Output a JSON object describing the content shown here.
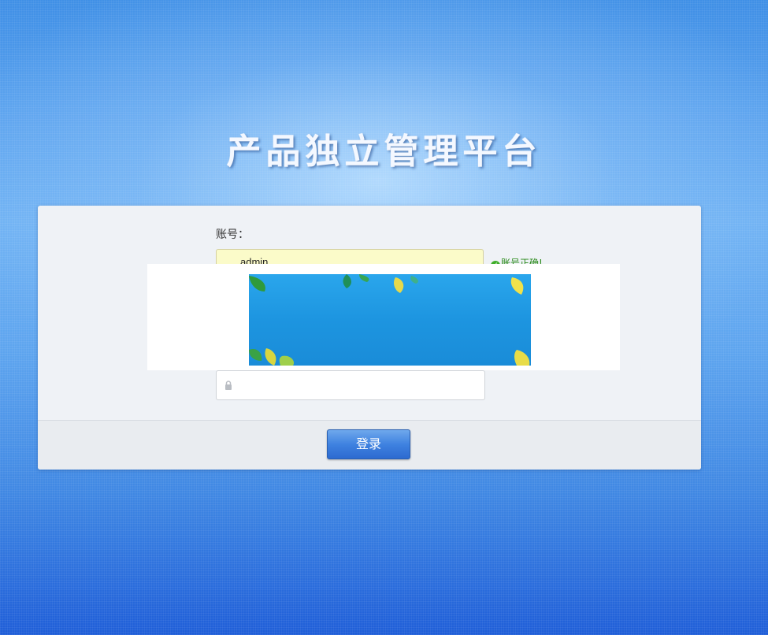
{
  "page": {
    "title": "产品独立管理平台"
  },
  "login_form": {
    "account_label": "账号：",
    "account_value": "admin",
    "account_status": "账号正确!",
    "password_value": "",
    "submit_label": "登录"
  },
  "icons": {
    "account_status_icon": "check-circle-icon",
    "password_icon": "lock-icon"
  },
  "colors": {
    "background_top": "#3f8fe6",
    "background_bottom": "#1f5ed8",
    "panel_bg": "#eff2f6",
    "account_input_bg": "#fbfbc9",
    "success_text": "#2a8a1a",
    "button_blue": "#3f82e0"
  }
}
